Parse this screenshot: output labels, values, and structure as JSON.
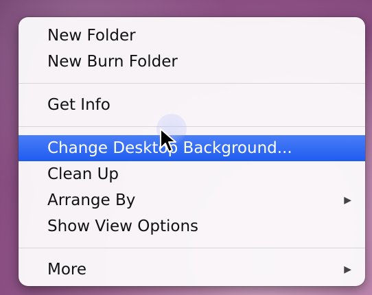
{
  "menu": {
    "groups": [
      [
        {
          "label": "New Folder",
          "submenu": false
        },
        {
          "label": "New Burn Folder",
          "submenu": false
        }
      ],
      [
        {
          "label": "Get Info",
          "submenu": false
        }
      ],
      [
        {
          "label": "Change Desktop Background...",
          "submenu": false,
          "highlighted": true
        },
        {
          "label": "Clean Up",
          "submenu": false
        },
        {
          "label": "Arrange By",
          "submenu": true
        },
        {
          "label": "Show View Options",
          "submenu": false
        }
      ],
      [
        {
          "label": "More",
          "submenu": true
        }
      ]
    ],
    "highlight_color": "#2a63f2",
    "submenu_icon": "triangle-right-icon"
  },
  "cursor": {
    "icon": "pointer-cursor-icon"
  }
}
